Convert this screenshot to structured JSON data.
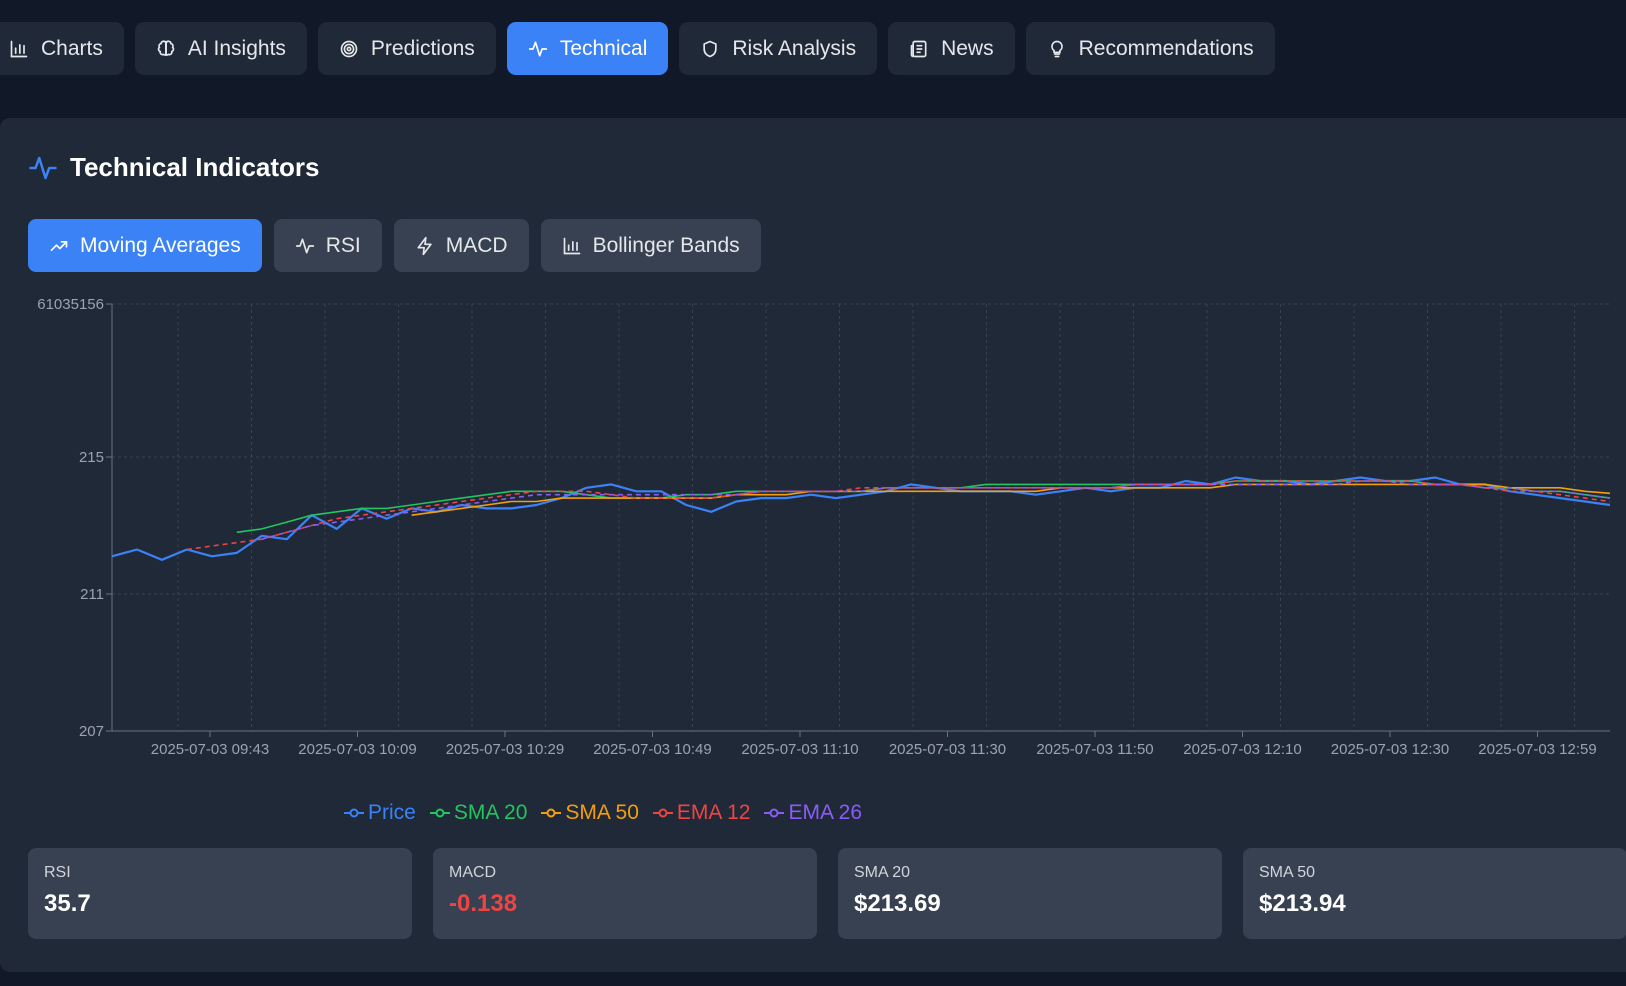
{
  "tabs": [
    {
      "label": "Charts",
      "icon": "bar-chart-icon",
      "active": false
    },
    {
      "label": "AI Insights",
      "icon": "brain-icon",
      "active": false
    },
    {
      "label": "Predictions",
      "icon": "target-icon",
      "active": false
    },
    {
      "label": "Technical",
      "icon": "activity-icon",
      "active": true
    },
    {
      "label": "Risk Analysis",
      "icon": "shield-icon",
      "active": false
    },
    {
      "label": "News",
      "icon": "newspaper-icon",
      "active": false
    },
    {
      "label": "Recommendations",
      "icon": "lightbulb-icon",
      "active": false
    }
  ],
  "panel": {
    "title": "Technical Indicators",
    "subtabs": [
      {
        "label": "Moving Averages",
        "active": true
      },
      {
        "label": "RSI",
        "active": false
      },
      {
        "label": "MACD",
        "active": false
      },
      {
        "label": "Bollinger Bands",
        "active": false
      }
    ]
  },
  "colors": {
    "accent": "#3b82f6",
    "price": "#3b82f6",
    "sma20": "#22c55e",
    "sma50": "#f59e0b",
    "ema12": "#ef4444",
    "ema26": "#8b5cf6",
    "negative": "#ef4444"
  },
  "chart_data": {
    "type": "line",
    "y_ticks": [
      "207",
      "211",
      "215",
      "61035156"
    ],
    "x_ticks": [
      "2025-07-03 09:43",
      "2025-07-03 10:09",
      "2025-07-03 10:29",
      "2025-07-03 10:49",
      "2025-07-03 11:10",
      "2025-07-03 11:30",
      "2025-07-03 11:50",
      "2025-07-03 12:10",
      "2025-07-03 12:30",
      "2025-07-03 12:59"
    ],
    "ylim": [
      207,
      219.5
    ],
    "grid": true,
    "series": [
      {
        "name": "Price",
        "color": "#3b82f6",
        "dashed": false,
        "values": [
          212.1,
          212.3,
          212.0,
          212.3,
          212.1,
          212.2,
          212.7,
          212.6,
          213.3,
          212.9,
          213.5,
          213.2,
          213.5,
          213.4,
          213.6,
          213.5,
          213.5,
          213.6,
          213.8,
          214.1,
          214.2,
          214.0,
          214.0,
          213.6,
          213.4,
          213.7,
          213.8,
          213.8,
          213.9,
          213.8,
          213.9,
          214.0,
          214.2,
          214.1,
          214.0,
          214.0,
          214.0,
          213.9,
          214.0,
          214.1,
          214.0,
          214.1,
          214.1,
          214.3,
          214.2,
          214.4,
          214.3,
          214.3,
          214.2,
          214.3,
          214.4,
          214.3,
          214.3,
          214.4,
          214.2,
          214.2,
          214.0,
          213.9,
          213.8,
          213.7,
          213.6
        ]
      },
      {
        "name": "SMA 20",
        "color": "#22c55e",
        "dashed": false,
        "values": [
          null,
          null,
          null,
          null,
          null,
          212.8,
          212.9,
          213.1,
          213.3,
          213.4,
          213.5,
          213.5,
          213.6,
          213.7,
          213.8,
          213.9,
          214.0,
          214.0,
          214.0,
          213.9,
          213.8,
          213.8,
          213.8,
          213.9,
          213.9,
          214.0,
          214.0,
          214.0,
          214.0,
          214.0,
          214.0,
          214.1,
          214.1,
          214.1,
          214.1,
          214.2,
          214.2,
          214.2,
          214.2,
          214.2,
          214.2,
          214.2,
          214.2,
          214.2,
          214.2,
          214.3,
          214.3,
          214.3,
          214.3,
          214.3,
          214.3,
          214.3,
          214.3,
          214.2,
          214.2,
          214.1,
          214.1,
          214.0,
          214.0,
          213.9,
          213.8
        ]
      },
      {
        "name": "SMA 50",
        "color": "#f59e0b",
        "dashed": false,
        "values": [
          null,
          null,
          null,
          null,
          null,
          null,
          null,
          null,
          null,
          null,
          null,
          null,
          213.3,
          213.4,
          213.5,
          213.6,
          213.7,
          213.7,
          213.8,
          213.8,
          213.8,
          213.8,
          213.8,
          213.8,
          213.8,
          213.9,
          213.9,
          213.9,
          214.0,
          214.0,
          214.0,
          214.0,
          214.0,
          214.0,
          214.0,
          214.0,
          214.0,
          214.0,
          214.1,
          214.1,
          214.1,
          214.1,
          214.1,
          214.1,
          214.1,
          214.2,
          214.2,
          214.2,
          214.2,
          214.2,
          214.2,
          214.2,
          214.2,
          214.2,
          214.2,
          214.2,
          214.1,
          214.1,
          214.1,
          214.0,
          213.94
        ]
      },
      {
        "name": "EMA 12",
        "color": "#ef4444",
        "dashed": true,
        "values": [
          null,
          null,
          null,
          212.3,
          212.4,
          212.5,
          212.6,
          212.8,
          213.0,
          213.2,
          213.3,
          213.4,
          213.5,
          213.6,
          213.7,
          213.8,
          213.9,
          214.0,
          214.0,
          214.0,
          213.9,
          213.8,
          213.8,
          213.8,
          213.8,
          213.9,
          214.0,
          214.0,
          214.0,
          214.0,
          214.1,
          214.1,
          214.1,
          214.1,
          214.1,
          214.1,
          214.1,
          214.1,
          214.1,
          214.1,
          214.1,
          214.2,
          214.2,
          214.2,
          214.2,
          214.3,
          214.3,
          214.3,
          214.3,
          214.3,
          214.3,
          214.3,
          214.3,
          214.2,
          214.2,
          214.1,
          214.0,
          214.0,
          213.9,
          213.8,
          213.7
        ]
      },
      {
        "name": "EMA 26",
        "color": "#8b5cf6",
        "dashed": true,
        "values": [
          null,
          null,
          null,
          null,
          null,
          null,
          212.6,
          212.8,
          213.0,
          213.1,
          213.2,
          213.3,
          213.4,
          213.5,
          213.6,
          213.7,
          213.8,
          213.9,
          213.9,
          213.9,
          213.9,
          213.9,
          213.9,
          213.9,
          213.9,
          213.9,
          214.0,
          214.0,
          214.0,
          214.0,
          214.0,
          214.1,
          214.1,
          214.1,
          214.1,
          214.1,
          214.1,
          214.1,
          214.1,
          214.1,
          214.1,
          214.2,
          214.2,
          214.2,
          214.2,
          214.2,
          214.2,
          214.2,
          214.2,
          214.2,
          214.3,
          214.3,
          214.2,
          214.2,
          214.2,
          214.1,
          214.1,
          214.0,
          214.0,
          213.9,
          213.8
        ]
      }
    ]
  },
  "stats": [
    {
      "label": "RSI",
      "value": "35.7",
      "negative": false
    },
    {
      "label": "MACD",
      "value": "-0.138",
      "negative": true
    },
    {
      "label": "SMA 20",
      "value": "$213.69",
      "negative": false
    },
    {
      "label": "SMA 50",
      "value": "$213.94",
      "negative": false
    }
  ]
}
